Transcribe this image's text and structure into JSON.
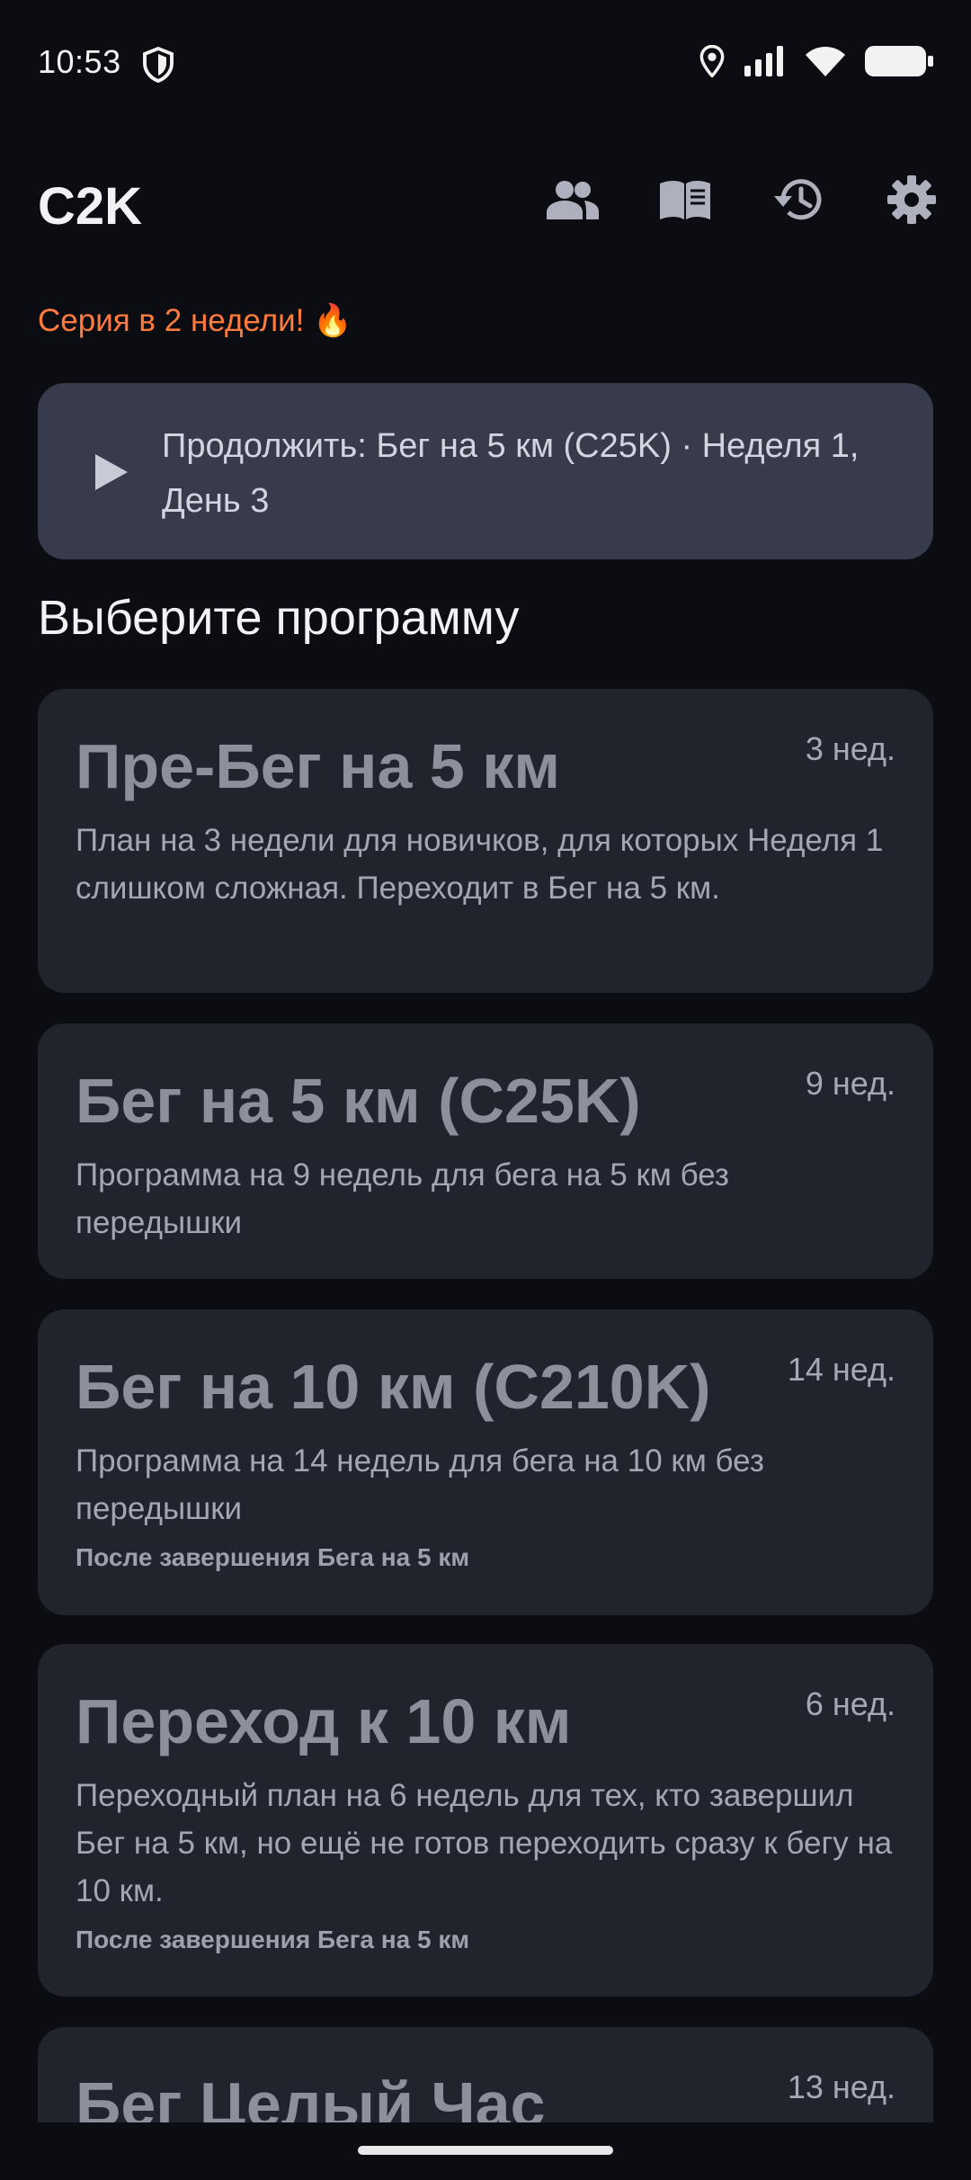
{
  "status_bar": {
    "time": "10:53",
    "icons": [
      "shield-icon",
      "location-icon",
      "signal-icon",
      "wifi-icon",
      "battery-icon"
    ]
  },
  "app_bar": {
    "title": "C2K",
    "actions": [
      "people-icon",
      "book-icon",
      "history-icon",
      "settings-icon"
    ]
  },
  "streak": "Серия в 2 недели! 🔥",
  "continue_banner": {
    "icon": "play-icon",
    "label": "Продолжить: Бег на 5 км (C25K) · Неделя 1, День 3"
  },
  "section_title": "Выберите программу",
  "programs": [
    {
      "title": "Пре-Бег на 5 км",
      "weeks": "3 нед.",
      "description": "План на 3 недели для новичков, для которых Неделя 1 слишком сложная. Переходит в Бег на 5 км.",
      "requirement": ""
    },
    {
      "title": "Бег на 5 км (C25K)",
      "weeks": "9 нед.",
      "description": "Программа на 9 недель для бега на 5 км без передышки",
      "requirement": ""
    },
    {
      "title": "Бег на 10 км (C210K)",
      "weeks": "14 нед.",
      "description": "Программа на 14 недель для бега на 10 км без передышки",
      "requirement": "После завершения Бега на 5 км"
    },
    {
      "title": "Переход к 10 км",
      "weeks": "6 нед.",
      "description": "Переходный план на 6 недель для тех, кто завершил Бег на 5 км, но ещё не готов переходить сразу к бегу на 10 км.",
      "requirement": "После завершения Бега на 5 км"
    },
    {
      "title": "Бег Целый Час",
      "weeks": "13 нед.",
      "description": "",
      "requirement": ""
    }
  ],
  "colors": {
    "background": "#0c0d12",
    "card": "#22242d",
    "banner": "#373b4b",
    "streak": "#ff7a3d"
  }
}
